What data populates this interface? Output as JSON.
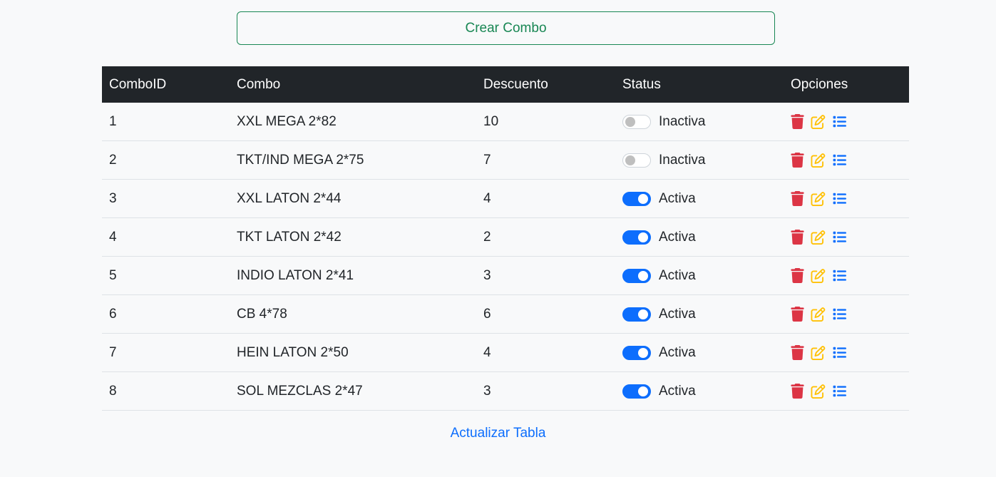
{
  "create_button": {
    "label": "Crear Combo"
  },
  "table": {
    "headers": [
      "ComboID",
      "Combo",
      "Descuento",
      "Status",
      "Opciones"
    ],
    "rows": [
      {
        "id": "1",
        "combo": "XXL MEGA 2*82",
        "descuento": "10",
        "active": false,
        "status": "Inactiva"
      },
      {
        "id": "2",
        "combo": "TKT/IND MEGA 2*75",
        "descuento": "7",
        "active": false,
        "status": "Inactiva"
      },
      {
        "id": "3",
        "combo": "XXL LATON 2*44",
        "descuento": "4",
        "active": true,
        "status": "Activa"
      },
      {
        "id": "4",
        "combo": "TKT LATON 2*42",
        "descuento": "2",
        "active": true,
        "status": "Activa"
      },
      {
        "id": "5",
        "combo": "INDIO LATON 2*41",
        "descuento": "3",
        "active": true,
        "status": "Activa"
      },
      {
        "id": "6",
        "combo": "CB 4*78",
        "descuento": "6",
        "active": true,
        "status": "Activa"
      },
      {
        "id": "7",
        "combo": "HEIN LATON 2*50",
        "descuento": "4",
        "active": true,
        "status": "Activa"
      },
      {
        "id": "8",
        "combo": "SOL MEZCLAS 2*47",
        "descuento": "3",
        "active": true,
        "status": "Activa"
      }
    ],
    "option_icons": [
      "trash-icon",
      "edit-icon",
      "list-icon"
    ]
  },
  "refresh_link": {
    "label": "Actualizar Tabla"
  },
  "colors": {
    "success": "#198754",
    "primary": "#0d6efd",
    "danger": "#dc3545",
    "warning": "#ffc107",
    "header_bg": "#212529"
  }
}
